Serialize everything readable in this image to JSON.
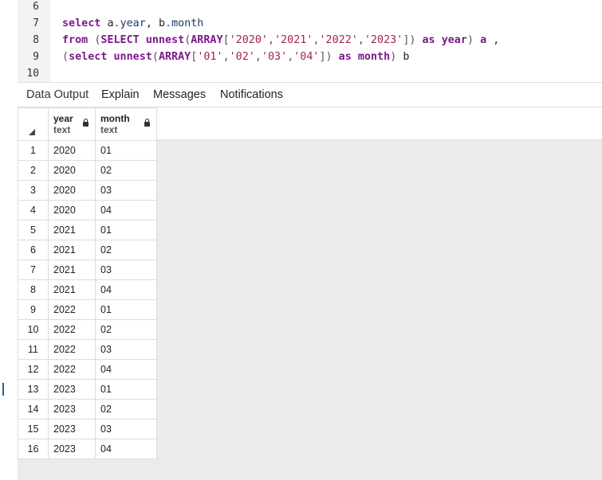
{
  "editor": {
    "lines": [
      {
        "num": "6",
        "tokens": []
      },
      {
        "num": "7",
        "tokens": [
          {
            "t": "select ",
            "c": "kw"
          },
          {
            "t": "a",
            "c": "plain"
          },
          {
            "t": ".",
            "c": "pn"
          },
          {
            "t": "year",
            "c": "id"
          },
          {
            "t": ", ",
            "c": "plain"
          },
          {
            "t": "b",
            "c": "plain"
          },
          {
            "t": ".",
            "c": "pn"
          },
          {
            "t": "month",
            "c": "id"
          }
        ]
      },
      {
        "num": "8",
        "tokens": [
          {
            "t": "from ",
            "c": "kw"
          },
          {
            "t": "(",
            "c": "pn"
          },
          {
            "t": "SELECT ",
            "c": "kw"
          },
          {
            "t": "unnest",
            "c": "kw"
          },
          {
            "t": "(",
            "c": "pn"
          },
          {
            "t": "ARRAY",
            "c": "kw"
          },
          {
            "t": "[",
            "c": "pn"
          },
          {
            "t": "'2020'",
            "c": "str"
          },
          {
            "t": ",",
            "c": "pn"
          },
          {
            "t": "'2021'",
            "c": "str"
          },
          {
            "t": ",",
            "c": "pn"
          },
          {
            "t": "'2022'",
            "c": "str"
          },
          {
            "t": ",",
            "c": "pn"
          },
          {
            "t": "'2023'",
            "c": "str"
          },
          {
            "t": "])",
            "c": "pn"
          },
          {
            "t": " as ",
            "c": "kw"
          },
          {
            "t": "year",
            "c": "kw"
          },
          {
            "t": ") ",
            "c": "pn"
          },
          {
            "t": "a ",
            "c": "kw"
          },
          {
            "t": ",",
            "c": "plain"
          }
        ]
      },
      {
        "num": "9",
        "tokens": [
          {
            "t": "(",
            "c": "pn"
          },
          {
            "t": "select ",
            "c": "kw"
          },
          {
            "t": "unnest",
            "c": "kw"
          },
          {
            "t": "(",
            "c": "pn"
          },
          {
            "t": "ARRAY",
            "c": "kw"
          },
          {
            "t": "[",
            "c": "pn"
          },
          {
            "t": "'01'",
            "c": "str"
          },
          {
            "t": ",",
            "c": "pn"
          },
          {
            "t": "'02'",
            "c": "str"
          },
          {
            "t": ",",
            "c": "pn"
          },
          {
            "t": "'03'",
            "c": "str"
          },
          {
            "t": ",",
            "c": "pn"
          },
          {
            "t": "'04'",
            "c": "str"
          },
          {
            "t": "])",
            "c": "pn"
          },
          {
            "t": " as ",
            "c": "kw"
          },
          {
            "t": "month",
            "c": "kw"
          },
          {
            "t": ") ",
            "c": "pn"
          },
          {
            "t": "b",
            "c": "plain"
          }
        ]
      },
      {
        "num": "10",
        "tokens": []
      }
    ]
  },
  "tabs": {
    "data_output": "Data Output",
    "explain": "Explain",
    "messages": "Messages",
    "notifications": "Notifications"
  },
  "grid": {
    "columns": [
      {
        "name": "year",
        "type": "text"
      },
      {
        "name": "month",
        "type": "text"
      }
    ],
    "rows": [
      {
        "n": "1",
        "year": "2020",
        "month": "01"
      },
      {
        "n": "2",
        "year": "2020",
        "month": "02"
      },
      {
        "n": "3",
        "year": "2020",
        "month": "03"
      },
      {
        "n": "4",
        "year": "2020",
        "month": "04"
      },
      {
        "n": "5",
        "year": "2021",
        "month": "01"
      },
      {
        "n": "6",
        "year": "2021",
        "month": "02"
      },
      {
        "n": "7",
        "year": "2021",
        "month": "03"
      },
      {
        "n": "8",
        "year": "2021",
        "month": "04"
      },
      {
        "n": "9",
        "year": "2022",
        "month": "01"
      },
      {
        "n": "10",
        "year": "2022",
        "month": "02"
      },
      {
        "n": "11",
        "year": "2022",
        "month": "03"
      },
      {
        "n": "12",
        "year": "2022",
        "month": "04"
      },
      {
        "n": "13",
        "year": "2023",
        "month": "01"
      },
      {
        "n": "14",
        "year": "2023",
        "month": "02"
      },
      {
        "n": "15",
        "year": "2023",
        "month": "03"
      },
      {
        "n": "16",
        "year": "2023",
        "month": "04"
      }
    ]
  },
  "colors": {
    "keyword": "#7a1a8a",
    "identifier": "#1b3a6b",
    "string": "#a0244f",
    "grid_background": "#ebebeb"
  }
}
